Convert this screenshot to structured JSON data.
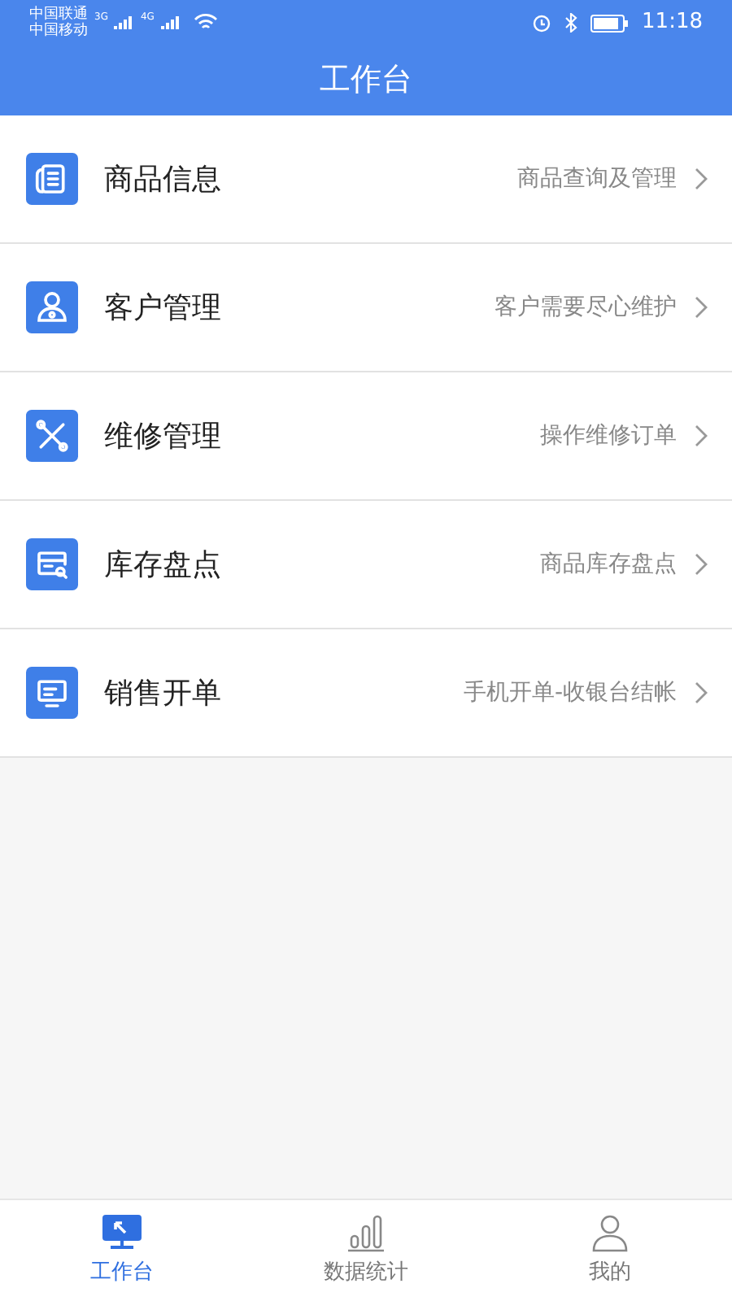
{
  "status_bar": {
    "carrier_1": "中国联通",
    "carrier_2": "中国移动",
    "network_1": "3G",
    "network_2": "4G",
    "time": "11:18"
  },
  "title": "工作台",
  "menu": [
    {
      "kind": "document",
      "label": "商品信息",
      "hint": "商品查询及管理"
    },
    {
      "kind": "user",
      "label": "客户管理",
      "hint": "客户需要尽心维护"
    },
    {
      "kind": "tools",
      "label": "维修管理",
      "hint": "操作维修订单"
    },
    {
      "kind": "inventory",
      "label": "库存盘点",
      "hint": "商品库存盘点"
    },
    {
      "kind": "monitor",
      "label": "销售开单",
      "hint": "手机开单-收银台结帐"
    }
  ],
  "tab_bar": [
    {
      "kind": "workbench",
      "label": "工作台",
      "selected": true
    },
    {
      "kind": "stats",
      "label": "数据统计",
      "selected": false
    },
    {
      "kind": "profile",
      "label": "我的",
      "selected": false
    }
  ]
}
